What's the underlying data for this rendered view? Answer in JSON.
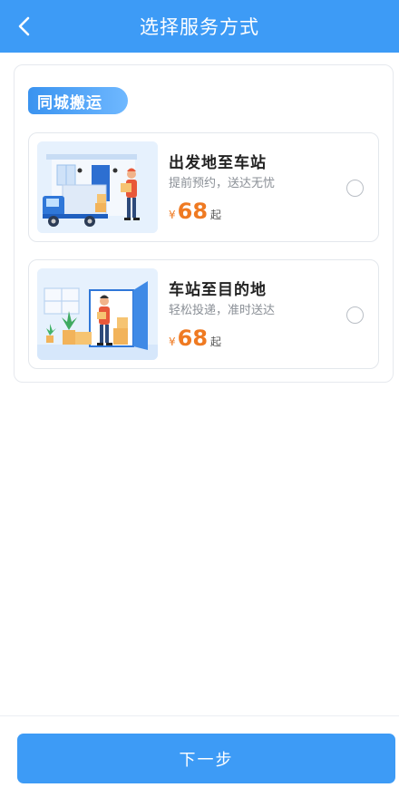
{
  "header": {
    "title": "选择服务方式"
  },
  "section": {
    "tag": "同城搬运"
  },
  "services": [
    {
      "name": "出发地至车站",
      "desc": "提前预约，送达无忧",
      "currency": "¥",
      "price": "68",
      "suffix": "起"
    },
    {
      "name": "车站至目的地",
      "desc": "轻松投递，准时送达",
      "currency": "¥",
      "price": "68",
      "suffix": "起"
    }
  ],
  "footer": {
    "next_label": "下一步"
  },
  "colors": {
    "primary": "#3d9bf6",
    "price": "#ef7a22"
  }
}
